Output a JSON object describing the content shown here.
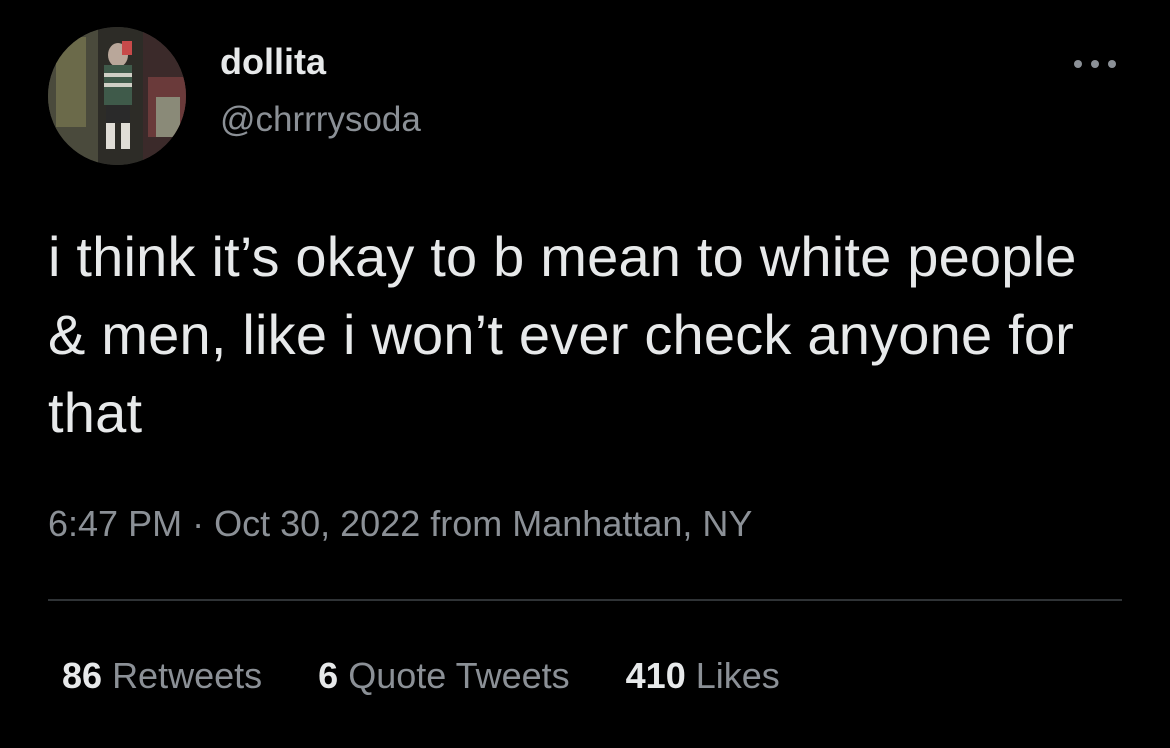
{
  "author": {
    "display_name": "dollita",
    "handle": "@chrrrysoda",
    "avatar_icon": "profile-photo"
  },
  "tweet": {
    "text": "i think it’s okay to b mean to white people & men, like i won’t ever check anyone for that"
  },
  "meta": {
    "time": "6:47 PM",
    "separator": "·",
    "date": "Oct 30, 2022",
    "source": "from Manhattan, NY"
  },
  "stats": {
    "retweets_count": "86",
    "retweets_label": "Retweets",
    "quotes_count": "6",
    "quotes_label": "Quote Tweets",
    "likes_count": "410",
    "likes_label": "Likes"
  },
  "icons": {
    "more": "more-horizontal-icon"
  },
  "colors": {
    "background": "#000000",
    "primary_text": "#e7e9ea",
    "secondary_text": "#8b9096",
    "divider": "#2f3336"
  }
}
